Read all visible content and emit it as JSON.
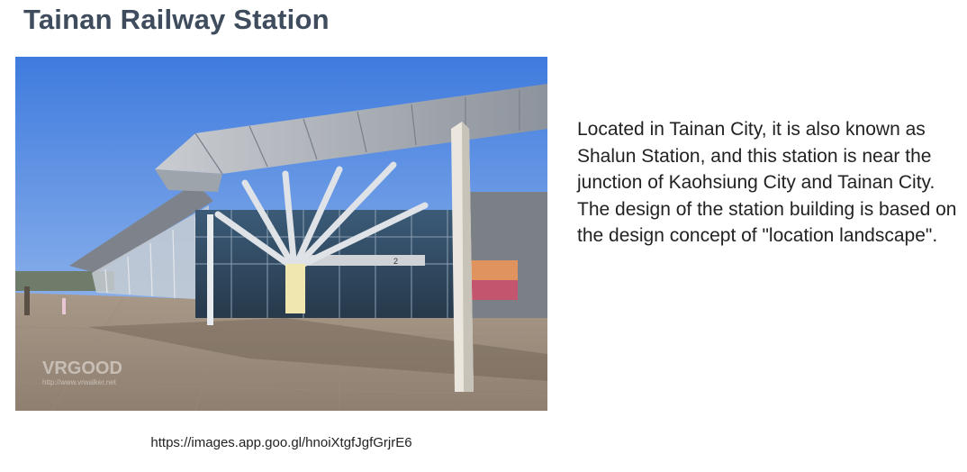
{
  "page": {
    "title": "Tainan Railway Station"
  },
  "photo": {
    "watermark": "VRGOOD",
    "watermark_url": "http://www.vrwalker.net",
    "sign_text": "2"
  },
  "caption": "https://images.app.goo.gl/hnoiXtgfJgfGrjrE6",
  "description": {
    "paragraph_1": "Located in Tainan City, it is also known as Shalun Station, and this station is near the junction of Kaohsiung City and Tainan City.",
    "paragraph_2": "The design of the station building is based on the design concept of \"location landscape\"."
  },
  "colors": {
    "title": "#3e4c5e",
    "text": "#222222",
    "sky": "#4f86e0"
  }
}
